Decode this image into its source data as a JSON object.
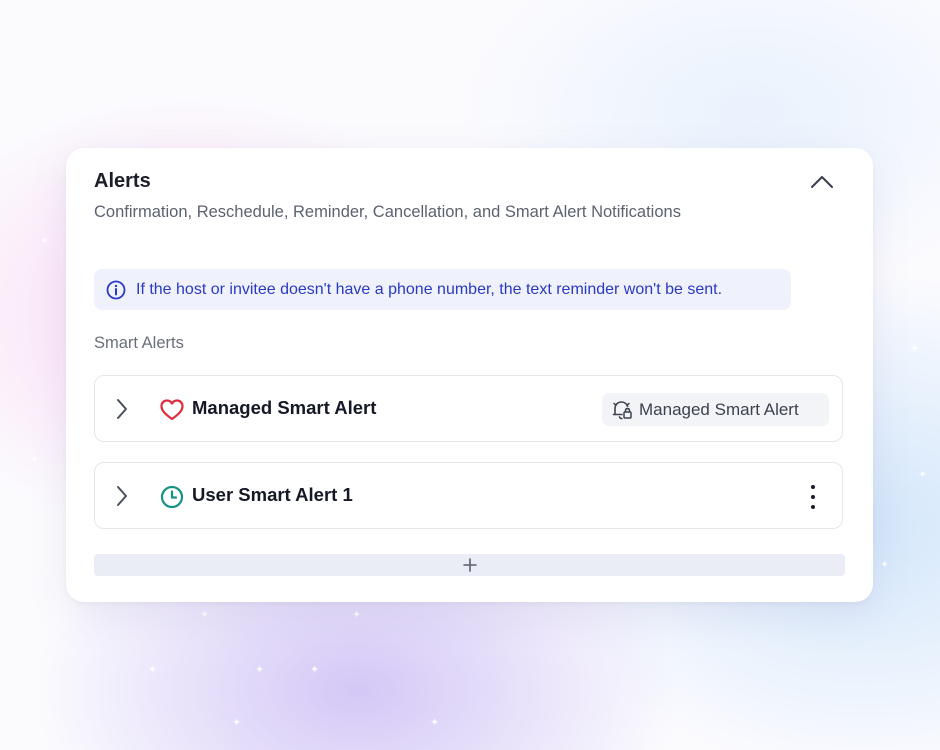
{
  "card": {
    "title": "Alerts",
    "subtitle": "Confirmation, Reschedule, Reminder, Cancellation, and Smart Alert Notifications",
    "collapse_icon": "chevron-up-icon"
  },
  "info_banner": {
    "icon": "info-circle-icon",
    "text": "If the host or invitee doesn't have a phone number, the text reminder won't be sent.",
    "color": "#2a39c4"
  },
  "section": {
    "label": "Smart Alerts"
  },
  "alerts": [
    {
      "name": "Managed Smart Alert",
      "icon": "heart-icon",
      "icon_color": "#e02b3b",
      "expand_icon": "chevron-right-icon",
      "badge": {
        "icon": "managed-bell-lock-icon",
        "label": "Managed Smart Alert"
      }
    },
    {
      "name": "User Smart Alert 1",
      "icon": "clock-icon",
      "icon_color": "#169283",
      "expand_icon": "chevron-right-icon",
      "menu_icon": "kebab-menu-icon"
    }
  ],
  "add_button": {
    "icon": "plus-icon"
  }
}
